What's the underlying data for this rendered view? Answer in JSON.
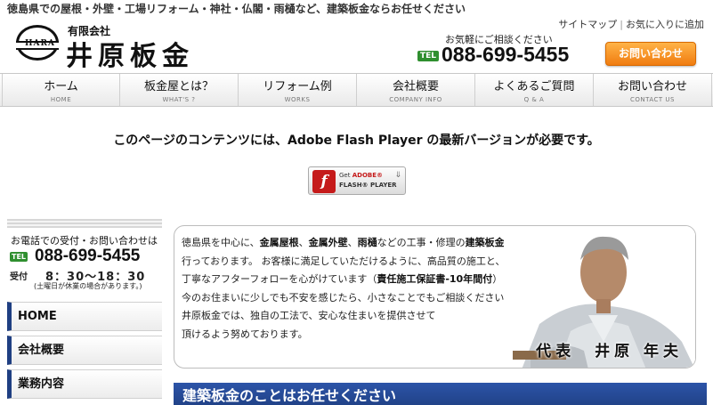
{
  "header": {
    "tagline": "徳島県での屋根・外壁・工場リフォーム・神社・仏閣・雨樋など、建築板金ならお任せください",
    "logo_small": "有限会社",
    "logo_main": "井原板金",
    "logo_emblem_text": "HARA",
    "util_links": [
      "サイトマップ",
      "お気に入りに追加"
    ],
    "util_sep": "|",
    "consult_text": "お気軽にご相談ください",
    "tel_badge": "TEL",
    "tel_number": "088-699-5455",
    "contact_button": "お問い合わせ"
  },
  "gnav": [
    {
      "label": "ホーム",
      "sub": "HOME"
    },
    {
      "label": "板金屋とは？",
      "sub": "WHAT'S ?"
    },
    {
      "label": "リフォーム例",
      "sub": "WORKS"
    },
    {
      "label": "会社概要",
      "sub": "COMPANY INFO"
    },
    {
      "label": "よくあるご質問",
      "sub": "Q & A"
    },
    {
      "label": "お問い合わせ",
      "sub": "CONTACT US"
    }
  ],
  "flash": {
    "message": "このページのコンテンツには、Adobe Flash Player の最新バージョンが必要です。",
    "button_logo": "f",
    "button_get": "Get",
    "button_adobe": "ADOBE®",
    "button_name": "FLASH® PLAYER",
    "button_dl": "⇓"
  },
  "sidebar": {
    "contact_title": "お電話での受付・お問い合わせは",
    "tel_badge": "TEL",
    "tel_number": "088-699-5455",
    "hours_label": "受付",
    "hours": "8：30〜18：30",
    "note": "(土曜日が休業の場合があります。)",
    "menu": [
      "HOME",
      "会社概要",
      "業務内容"
    ]
  },
  "intro": {
    "p1": "徳島県を中心に、",
    "p1b": "金属屋根",
    "p1c": "、",
    "p1d": "金属外壁",
    "p1e": "、",
    "p1f": "雨樋",
    "p1g": "などの工事・修理の",
    "p1h": "建築板金業",
    "p1i": "を",
    "line2": "行っております。 お客様に満足していただけるように、高品質の施工と、",
    "line3a": "丁寧なアフターフォローを心がけています（",
    "line3b": "責任施工保証書-10年間付",
    "line3c": "）",
    "line4": "今のお住まいに少しでも不安を感じたら、小さなことでもご相談ください。",
    "line5": "井原板金では、独自の工法で、安心な住まいを提供させて",
    "line6": "頂けるよう努めております。",
    "caption": "代表　井原 年夫"
  },
  "section_heading": "建築板金のことはお任せください"
}
